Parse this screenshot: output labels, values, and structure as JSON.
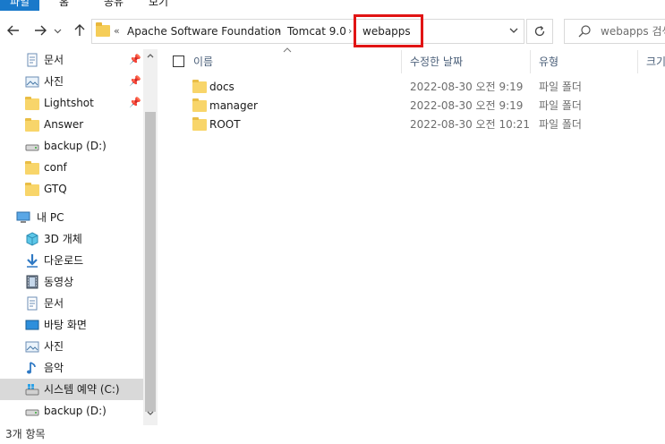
{
  "ribbon": {
    "tabs": [
      "파일",
      "홈",
      "공유",
      "보기"
    ]
  },
  "nav": {
    "back_icon": "arrow-left-icon",
    "forward_icon": "arrow-right-icon",
    "up_icon": "arrow-up-icon"
  },
  "address": {
    "overflow": "«",
    "crumbs": [
      "Apache Software Foundation",
      "Tomcat 9.0",
      "webapps"
    ],
    "separator": "›"
  },
  "search": {
    "placeholder": "webapps 검색"
  },
  "sidebar": {
    "quick_access": [
      {
        "label": "문서",
        "icon": "document-icon",
        "pinned": true
      },
      {
        "label": "사진",
        "icon": "pictures-icon",
        "pinned": true
      },
      {
        "label": "Lightshot",
        "icon": "folder-icon",
        "pinned": true
      },
      {
        "label": "Answer",
        "icon": "folder-icon",
        "pinned": false
      },
      {
        "label": "backup (D:)",
        "icon": "drive-icon",
        "pinned": false
      },
      {
        "label": "conf",
        "icon": "folder-icon",
        "pinned": false
      },
      {
        "label": "GTQ",
        "icon": "folder-icon",
        "pinned": false
      }
    ],
    "this_pc": {
      "label": "내 PC",
      "icon": "computer-icon"
    },
    "pc_items": [
      {
        "label": "3D 개체",
        "icon": "3d-objects-icon"
      },
      {
        "label": "다운로드",
        "icon": "download-icon"
      },
      {
        "label": "동영상",
        "icon": "video-icon"
      },
      {
        "label": "문서",
        "icon": "document-icon"
      },
      {
        "label": "바탕 화면",
        "icon": "desktop-icon"
      },
      {
        "label": "사진",
        "icon": "pictures-icon"
      },
      {
        "label": "음악",
        "icon": "music-icon"
      },
      {
        "label": "시스템 예약 (C:)",
        "icon": "system-drive-icon"
      },
      {
        "label": "backup (D:)",
        "icon": "drive-icon"
      }
    ]
  },
  "columns": {
    "name": "이름",
    "date": "수정한 날짜",
    "type": "유형",
    "size": "크기"
  },
  "files": [
    {
      "name": "docs",
      "date": "2022-08-30 오전 9:19",
      "type": "파일 폴더"
    },
    {
      "name": "manager",
      "date": "2022-08-30 오전 9:19",
      "type": "파일 폴더"
    },
    {
      "name": "ROOT",
      "date": "2022-08-30 오전 10:21",
      "type": "파일 폴더"
    }
  ],
  "status": {
    "item_count": "3개 항목"
  },
  "colors": {
    "accent": "#1979ca",
    "highlight": "#e11414",
    "selected": "#d9d9d9",
    "folder": "#f8d56a"
  }
}
